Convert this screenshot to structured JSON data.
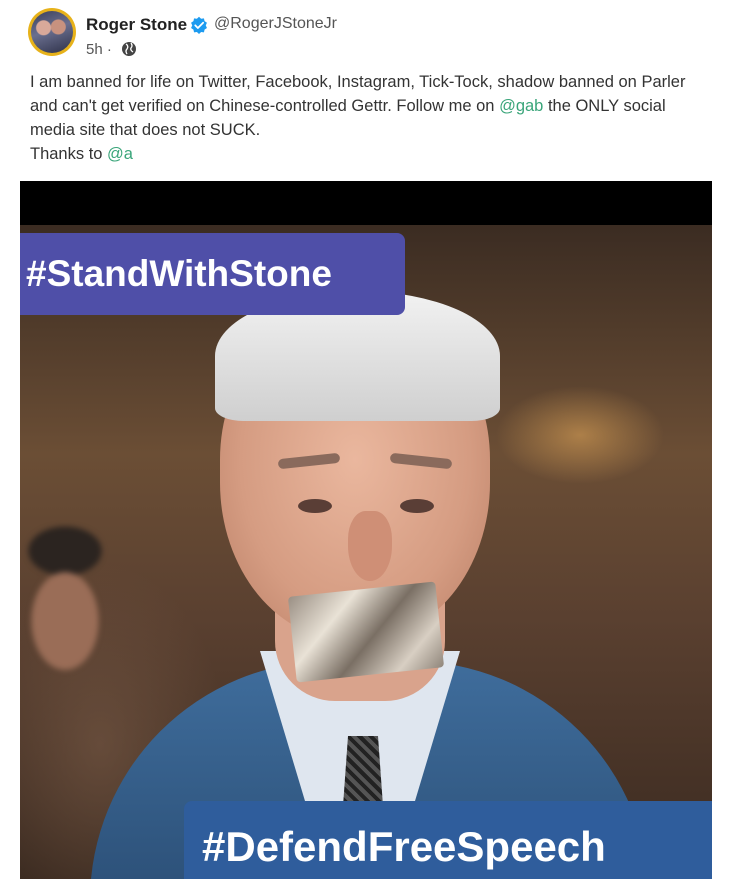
{
  "author": {
    "name": "Roger Stone",
    "handle": "@RogerJStoneJr",
    "time": "5h ·",
    "avatar_icon": "user-avatar",
    "verified_icon": "verified-badge-icon",
    "visibility_icon": "globe-icon"
  },
  "post": {
    "text_part1": "I am banned for life on Twitter, Facebook, Instagram, Tick-Tock, shadow banned on Parler and can't get verified on Chinese-controlled Gettr. Follow me on ",
    "mention_gab": "@gab",
    "text_part2": " the ONLY social media site that does not SUCK.",
    "thanks": "Thanks to ",
    "mention_a": "@a"
  },
  "image": {
    "tag_top": "#StandWithStone",
    "tag_bottom": "#DefendFreeSpeech"
  },
  "colors": {
    "link": "#3aa57a",
    "verified": "#1d9bf0",
    "tag_top_bg": "#4f4fa8",
    "tag_bottom_bg": "#2f5d9c"
  }
}
